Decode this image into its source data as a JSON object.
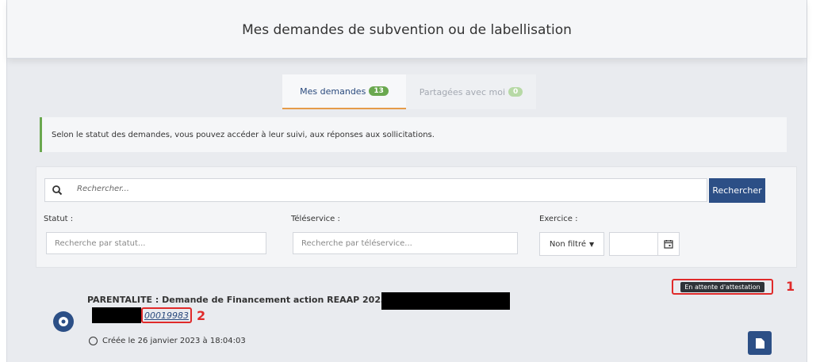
{
  "header": {
    "title": "Mes demandes de subvention ou de labellisation"
  },
  "tabs": [
    {
      "label": "Mes demandes",
      "count": "13"
    },
    {
      "label": "Partagées avec moi",
      "count": "0"
    }
  ],
  "info": {
    "text": "Selon le statut des demandes, vous pouvez accéder à leur suivi, aux réponses aux sollicitations."
  },
  "search": {
    "placeholder": "Rechercher...",
    "button": "Rechercher",
    "statut_label": "Statut :",
    "statut_placeholder": "Recherche par statut...",
    "teleservice_label": "Téléservice :",
    "teleservice_placeholder": "Recherche par téléservice...",
    "exercice_label": "Exercice :",
    "exercice_value": "Non filtré"
  },
  "item": {
    "status": "En attente d'attestation",
    "title": "PARENTALITE : Demande de Financement action REAAP 2023",
    "reference": "00019983",
    "created": "Créée le 26 janvier 2023 à 18:04:03"
  },
  "annotations": {
    "one": "1",
    "two": "2"
  },
  "colors": {
    "primary": "#2c4f86",
    "green": "#6aa84f",
    "annotation": "#e02a2a"
  }
}
